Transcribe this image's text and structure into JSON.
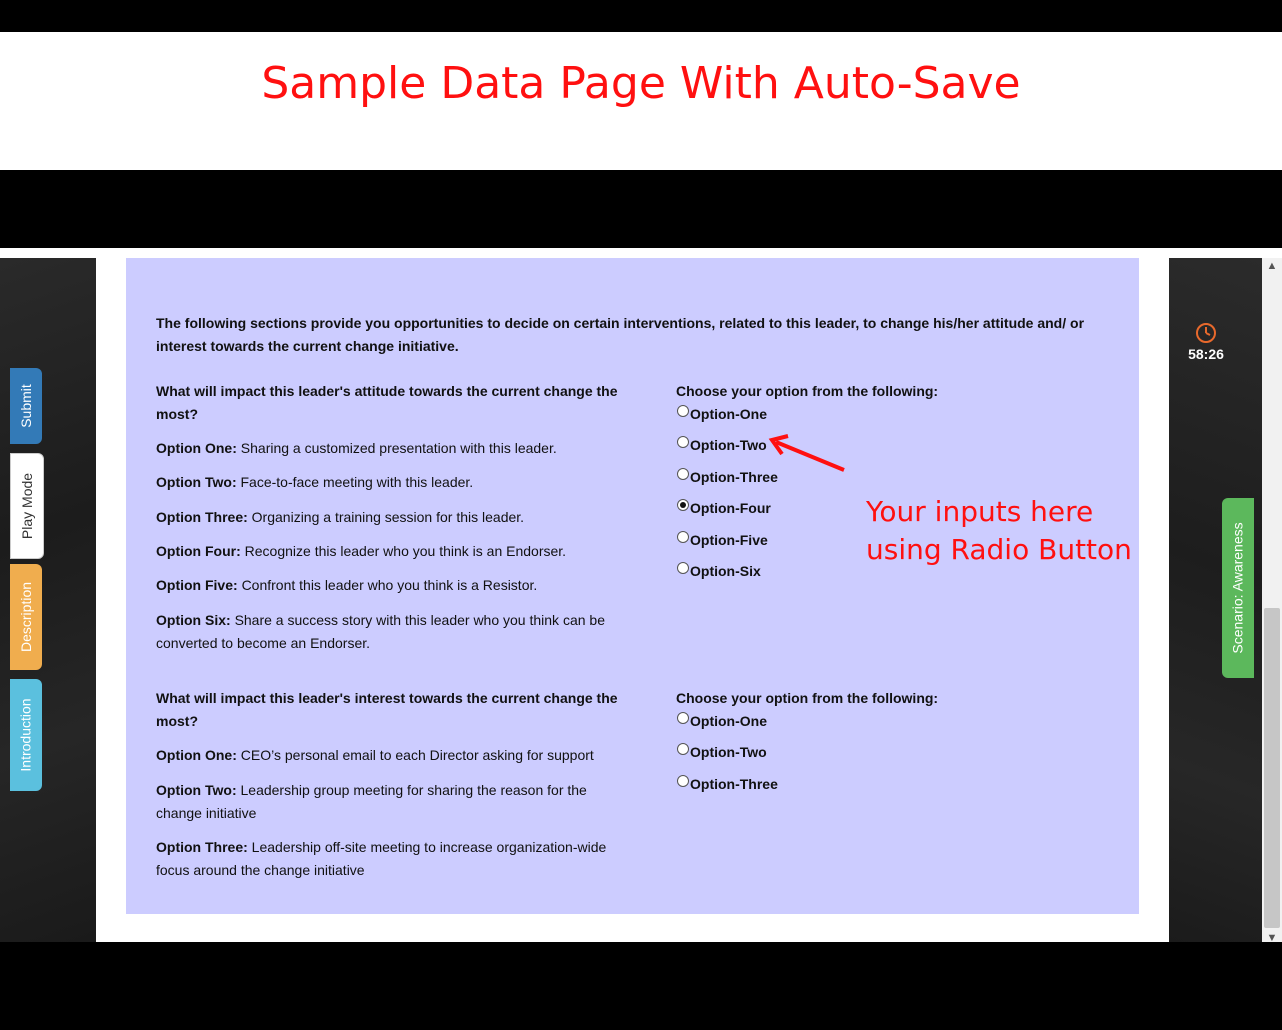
{
  "slide": {
    "title": "Sample Data Page With Auto-Save"
  },
  "side_tabs": {
    "submit": "Submit",
    "play_mode": "Play Mode",
    "description": "Description",
    "introduction": "Introduction"
  },
  "right": {
    "timer": "58:26",
    "scenario_tab": "Scenario: Awareness"
  },
  "content": {
    "intro": "The following sections provide you opportunities to decide on certain interventions, related to this leader, to change his/her attitude and/ or interest towards the current change initiative.",
    "q1": {
      "question": "What will impact this leader's attitude towards the current change the most?",
      "choose": "Choose your option from the following:",
      "descriptions": [
        {
          "label": "Option One:",
          "text": "Sharing a customized presentation with this leader."
        },
        {
          "label": "Option Two:",
          "text": "Face-to-face meeting with this leader."
        },
        {
          "label": "Option Three:",
          "text": "Organizing a training session for this leader."
        },
        {
          "label": "Option Four:",
          "text": "Recognize this leader who you think is an Endorser."
        },
        {
          "label": "Option Five:",
          "text": "Confront this leader who you think is a Resistor."
        },
        {
          "label": "Option Six:",
          "text": "Share a success story with this leader who you think can be converted to become an Endorser."
        }
      ],
      "radios": [
        "Option-One",
        "Option-Two",
        "Option-Three",
        "Option-Four",
        "Option-Five",
        "Option-Six"
      ],
      "selected": "Option-Four"
    },
    "q2": {
      "question": "What will impact this leader's interest towards the current change the most?",
      "choose": "Choose your option from the following:",
      "descriptions": [
        {
          "label": "Option One:",
          "text": "CEO’s personal email to each Director asking for support"
        },
        {
          "label": "Option Two:",
          "text": "Leadership group meeting for sharing the reason for the change initiative"
        },
        {
          "label": "Option Three:",
          "text": "Leadership off-site meeting to increase organization-wide focus around the change initiative"
        }
      ],
      "radios": [
        "Option-One",
        "Option-Two",
        "Option-Three"
      ],
      "selected": ""
    }
  },
  "annotation": {
    "line1": "Your inputs here",
    "line2": "using Radio Button",
    "color": "#ff1010"
  },
  "colors": {
    "panel": "#ccccff",
    "submit": "#337ab7",
    "description": "#f0ad4e",
    "introduction": "#5bc0de",
    "scenario": "#5cb85c"
  },
  "icons": {
    "timer": "clock-icon",
    "arrow": "red-arrow-icon"
  }
}
